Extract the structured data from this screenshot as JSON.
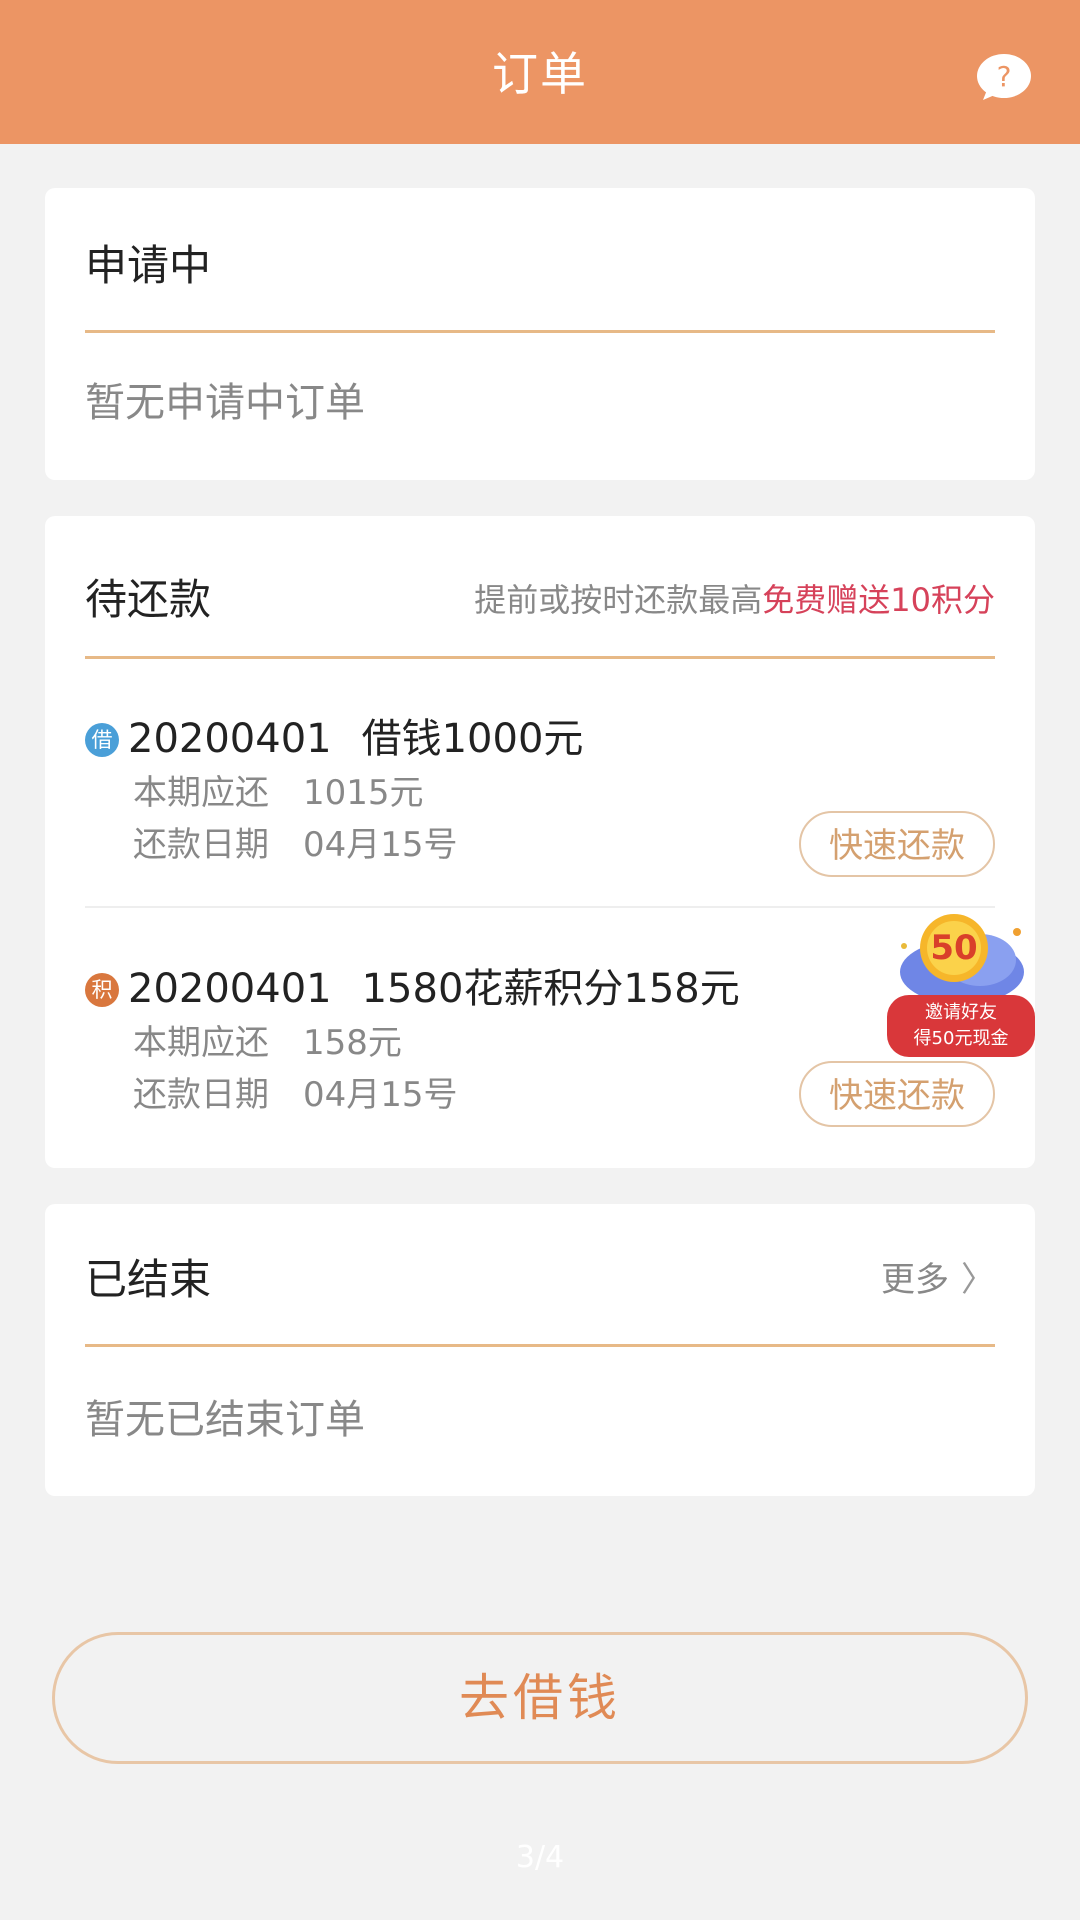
{
  "header": {
    "title": "订单",
    "help_icon": "question-icon"
  },
  "applying": {
    "title": "申请中",
    "empty_text": "暂无申请中订单"
  },
  "pending": {
    "title": "待还款",
    "promo_prefix": "提前或按时还款最高",
    "promo_highlight": "免费赠送10积分",
    "orders": [
      {
        "badge": "借",
        "badge_color": "#4a9fd8",
        "order_no": "20200401",
        "desc": "借钱1000元",
        "amount_label": "本期应还",
        "amount": "1015元",
        "date_label": "还款日期",
        "date": "04月15号",
        "button": "快速还款"
      },
      {
        "badge": "积",
        "badge_color": "#d9773e",
        "order_no": "20200401",
        "desc": "1580花薪积分158元",
        "amount_label": "本期应还",
        "amount": "158元",
        "date_label": "还款日期",
        "date": "04月15号",
        "button": "快速还款"
      }
    ]
  },
  "finished": {
    "title": "已结束",
    "more": "更多",
    "empty_text": "暂无已结束订单"
  },
  "invite_badge": {
    "number": "50",
    "line1": "邀请好友",
    "line2": "得50元现金"
  },
  "borrow_button": "去借钱",
  "page_indicator": "3/4",
  "colors": {
    "header": "#ec9564",
    "accent_line": "#e7b987",
    "highlight": "#d6425a",
    "button_text": "#e08a55"
  }
}
